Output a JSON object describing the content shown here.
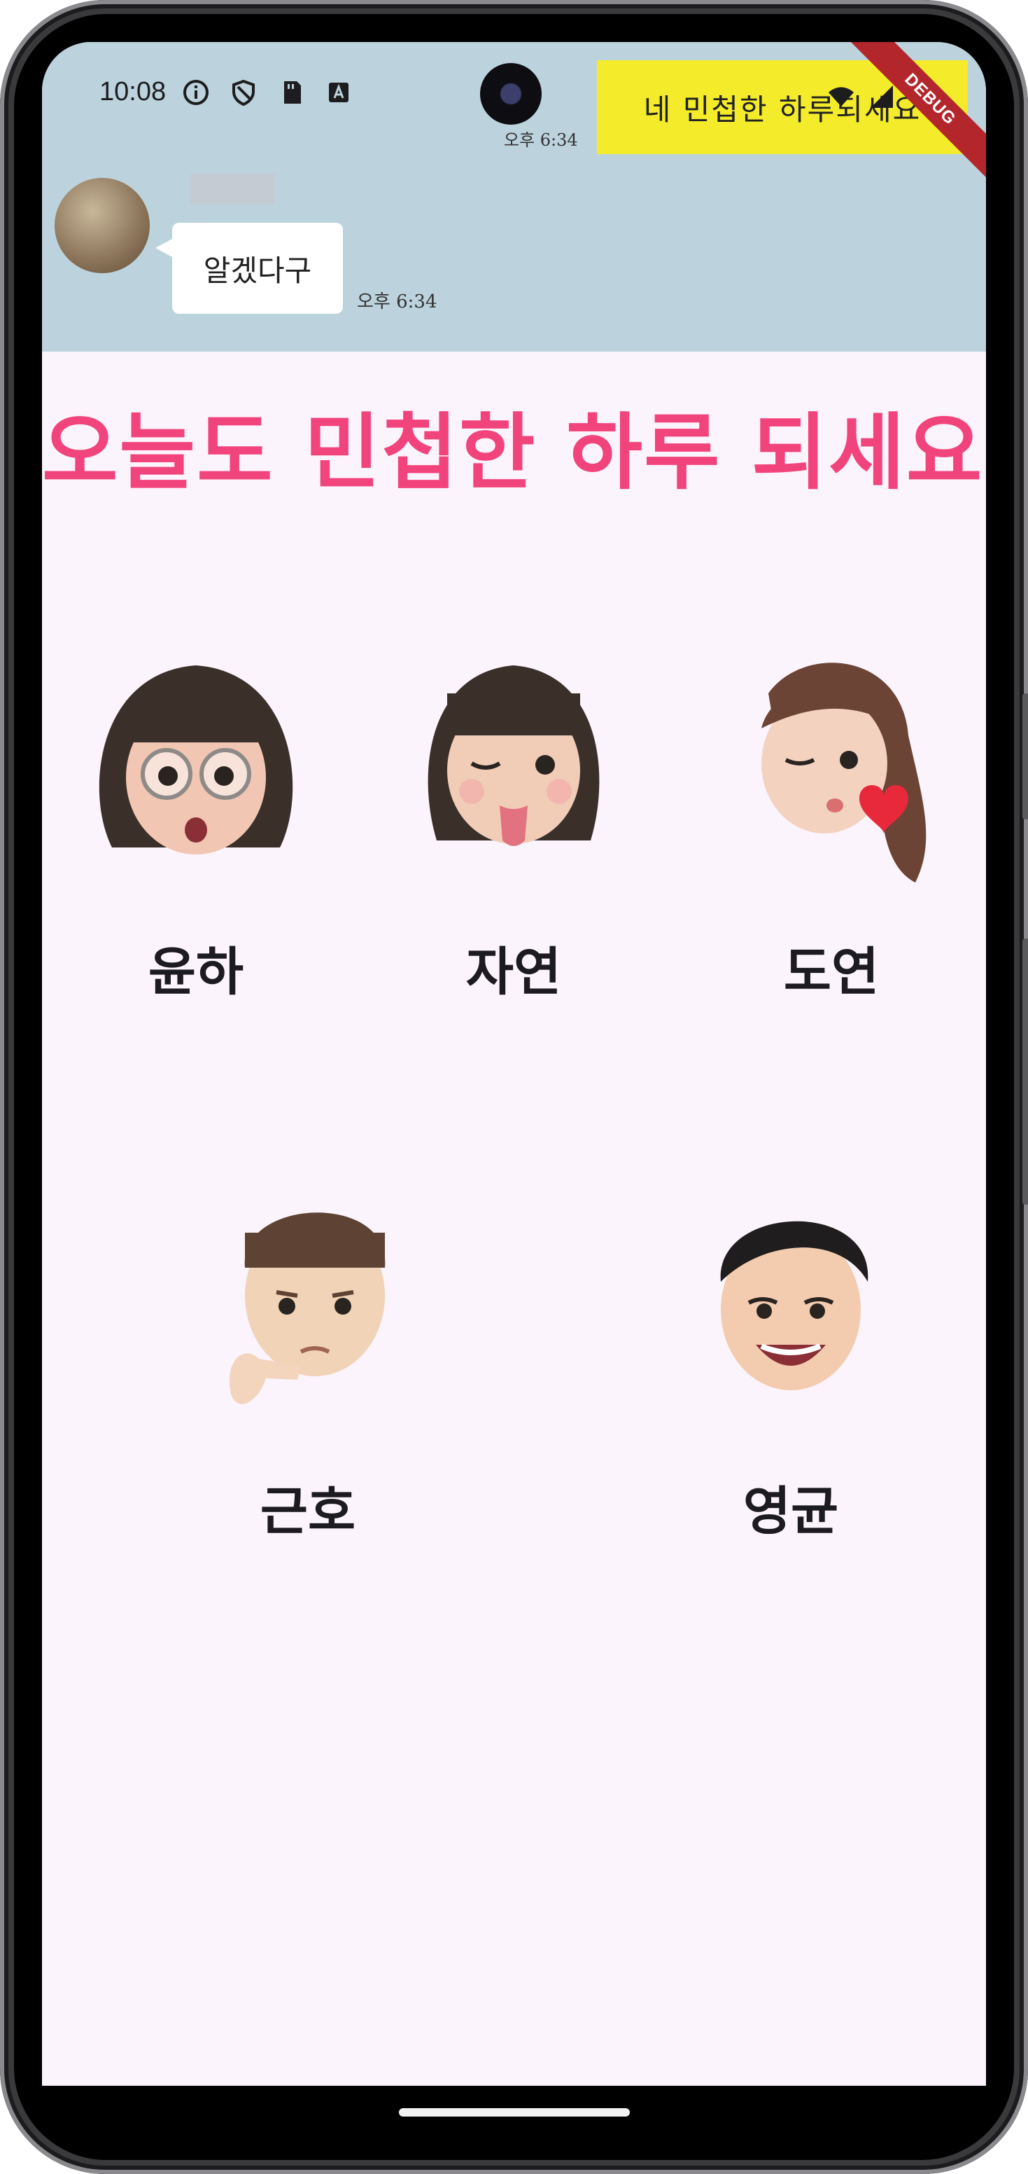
{
  "status_bar": {
    "time": "10:08",
    "icons": [
      "info-icon",
      "shield-icon",
      "sd-card-icon",
      "text-a-icon",
      "wifi-icon",
      "signal-icon"
    ]
  },
  "chat_banner": {
    "sent_message": "네 민첩한 하루되세요",
    "sent_time": "오후 6:34",
    "received_message": "알겠다구",
    "received_time": "오후 6:34"
  },
  "debug_banner": "DEBUG",
  "headline": "오늘도 민첩한 하루 되세요.",
  "people": [
    {
      "name": "윤하",
      "icon": "memoji-glasses-girl-icon"
    },
    {
      "name": "자연",
      "icon": "memoji-tongue-girl-icon"
    },
    {
      "name": "도연",
      "icon": "memoji-kiss-girl-icon"
    },
    {
      "name": "근호",
      "icon": "memoji-thinking-boy-icon"
    },
    {
      "name": "영균",
      "icon": "memoji-smiling-boy-icon"
    }
  ],
  "colors": {
    "headline": "#f2447c",
    "background": "#fcf4fc",
    "chat_banner": "#bcd2dc",
    "sent_bubble": "#f4ec2a",
    "debug_ribbon": "#b3262c"
  }
}
